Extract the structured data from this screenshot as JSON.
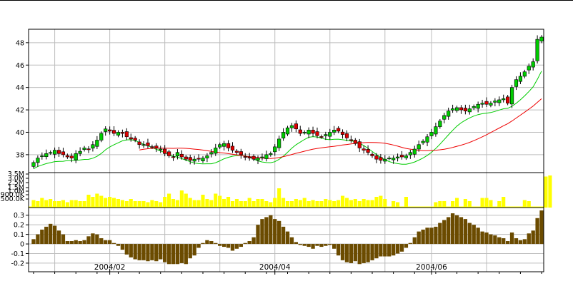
{
  "chart_data": {
    "type": "candlestick",
    "panels": {
      "price": {
        "y_ticks": [
          38,
          40,
          42,
          44,
          46,
          48
        ],
        "ylim": [
          36.4,
          49.2
        ],
        "colors": {
          "up": "#00cc00",
          "down": "#e00000",
          "ma_short": "#00cc00",
          "ma_long": "#ee0000"
        }
      },
      "volume": {
        "y_tick_labels": [
          "3.5M",
          "3.0M",
          "2.5M",
          "1.5M",
          "1.0M",
          "900.0K",
          "500.0K"
        ],
        "color": "#ffff00"
      },
      "oscillator": {
        "y_ticks": [
          0.3,
          0.2,
          0.1,
          0,
          -0.1,
          -0.2
        ],
        "ylim": [
          -0.29,
          0.38
        ],
        "color": "#6b4b00"
      }
    },
    "x_axis": {
      "month_labels": [
        {
          "index": 18,
          "label": "2004/02"
        },
        {
          "index": 57,
          "label": "2004/04"
        },
        {
          "index": 94,
          "label": "2004/06"
        }
      ]
    },
    "series": {
      "close": [
        37.3,
        37.7,
        37.9,
        38.1,
        38.2,
        38.4,
        38.1,
        38.0,
        37.8,
        37.7,
        38.1,
        38.3,
        38.6,
        38.5,
        38.9,
        39.3,
        39.9,
        40.3,
        40.1,
        39.9,
        40.0,
        39.9,
        39.6,
        39.4,
        39.3,
        38.9,
        38.9,
        38.8,
        38.7,
        38.6,
        38.5,
        38.1,
        37.9,
        37.8,
        38.2,
        37.8,
        37.6,
        37.5,
        37.6,
        37.6,
        37.7,
        37.9,
        38.2,
        38.6,
        38.9,
        39.0,
        38.6,
        38.4,
        38.2,
        38.0,
        37.8,
        37.7,
        37.6,
        37.7,
        37.8,
        38.0,
        38.1,
        38.7,
        39.4,
        40.0,
        40.4,
        40.6,
        40.3,
        39.9,
        40.0,
        40.2,
        39.9,
        39.7,
        39.6,
        39.8,
        40.0,
        40.2,
        40.1,
        39.8,
        39.5,
        39.3,
        39.0,
        38.6,
        38.4,
        38.2,
        37.9,
        37.6,
        37.5,
        37.6,
        37.7,
        37.7,
        37.8,
        37.8,
        37.9,
        38.2,
        38.5,
        38.9,
        39.2,
        39.6,
        40.0,
        40.5,
        41.0,
        41.5,
        41.9,
        42.1,
        42.2,
        42.0,
        41.9,
        42.1,
        42.3,
        42.5,
        42.6,
        42.5,
        42.6,
        42.8,
        42.9,
        43.0,
        42.6,
        44.0,
        44.7,
        45.0,
        45.4,
        45.9,
        46.3,
        48.3,
        48.5
      ],
      "volume": [
        0.7,
        0.6,
        0.9,
        0.7,
        0.8,
        0.6,
        0.6,
        0.7,
        0.5,
        0.7,
        0.7,
        0.6,
        0.6,
        1.2,
        1.0,
        1.3,
        1.1,
        0.9,
        1.0,
        0.9,
        0.8,
        0.7,
        0.6,
        0.8,
        0.6,
        0.6,
        0.6,
        0.5,
        0.7,
        0.6,
        0.5,
        1.0,
        1.3,
        0.8,
        0.7,
        1.6,
        1.3,
        0.9,
        0.7,
        0.7,
        1.2,
        0.8,
        0.7,
        1.3,
        1.1,
        0.8,
        1.0,
        0.6,
        0.8,
        0.6,
        0.6,
        0.9,
        0.6,
        0.8,
        0.8,
        0.6,
        0.5,
        0.9,
        1.8,
        0.9,
        0.6,
        0.6,
        0.8,
        0.7,
        0.9,
        0.6,
        0.7,
        0.6,
        0.6,
        0.8,
        0.7,
        0.6,
        0.7,
        1.1,
        0.9,
        0.7,
        0.8,
        0.6,
        0.8,
        0.7,
        0.7,
        1.0,
        1.1,
        0.8,
        0,
        0.6,
        0.5,
        0,
        1.0,
        0,
        0,
        0,
        0,
        0,
        0,
        0.5,
        0.6,
        0.6,
        0,
        0.6,
        0.9,
        0,
        0.8,
        0.6,
        0,
        0,
        0.9,
        0.9,
        0.7,
        0,
        0.6,
        1.0,
        0,
        0,
        0,
        0,
        0.7,
        0.6,
        0,
        0,
        0,
        2.9,
        3.0
      ],
      "oscillator": [
        0.05,
        0.1,
        0.15,
        0.18,
        0.21,
        0.19,
        0.14,
        0.1,
        0.03,
        0.03,
        0.04,
        0.03,
        0.04,
        0.08,
        0.11,
        0.1,
        0.06,
        0.04,
        0.04,
        0.01,
        -0.02,
        -0.06,
        -0.11,
        -0.14,
        -0.16,
        -0.17,
        -0.17,
        -0.18,
        -0.17,
        -0.18,
        -0.16,
        -0.19,
        -0.21,
        -0.21,
        -0.21,
        -0.2,
        -0.21,
        -0.15,
        -0.12,
        -0.04,
        0.01,
        0.04,
        0.03,
        0.01,
        -0.02,
        -0.03,
        -0.04,
        -0.07,
        -0.05,
        -0.03,
        0.01,
        0.03,
        0.07,
        0.2,
        0.26,
        0.28,
        0.3,
        0.26,
        0.24,
        0.18,
        0.13,
        0.07,
        0.02,
        -0.01,
        -0.02,
        -0.03,
        -0.05,
        -0.02,
        -0.03,
        -0.02,
        -0.01,
        -0.05,
        -0.12,
        -0.17,
        -0.19,
        -0.2,
        -0.18,
        -0.21,
        -0.2,
        -0.19,
        -0.17,
        -0.15,
        -0.13,
        -0.13,
        -0.13,
        -0.12,
        -0.1,
        -0.08,
        -0.04,
        0.01,
        0.07,
        0.13,
        0.15,
        0.17,
        0.17,
        0.18,
        0.22,
        0.25,
        0.28,
        0.32,
        0.3,
        0.28,
        0.26,
        0.22,
        0.2,
        0.17,
        0.13,
        0.12,
        0.1,
        0.09,
        0.07,
        0.06,
        0.03,
        0.12,
        0.06,
        0.04,
        0.05,
        0.11,
        0.14,
        0.27,
        0.35
      ]
    }
  }
}
